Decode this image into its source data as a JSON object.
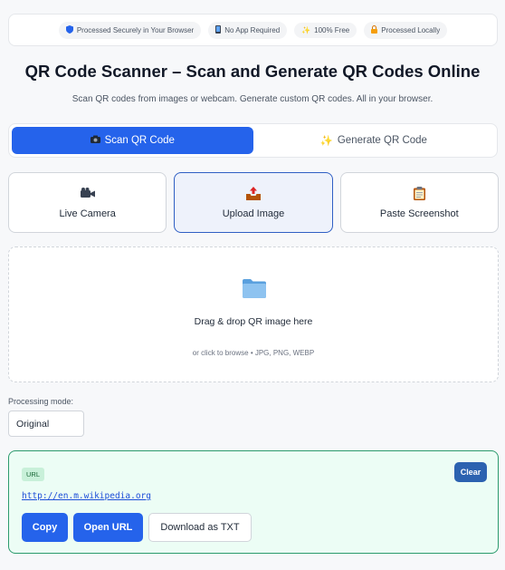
{
  "trust_bar": {
    "badges": [
      {
        "icon": "shield-icon",
        "label": "Processed Securely in Your Browser"
      },
      {
        "icon": "phone-icon",
        "label": "No App Required"
      },
      {
        "icon": "sparkle-icon",
        "label": "100% Free"
      },
      {
        "icon": "lock-icon",
        "label": "Processed Locally"
      }
    ]
  },
  "header": {
    "title": "QR Code Scanner – Scan and Generate QR Codes Online",
    "subtitle": "Scan QR codes from images or webcam. Generate custom QR codes. All in your browser."
  },
  "mode_tabs": [
    {
      "icon": "camera-icon",
      "label": "Scan QR Code",
      "active": true
    },
    {
      "icon": "sparkle-icon",
      "label": "Generate QR Code",
      "active": false
    }
  ],
  "sources": [
    {
      "icon": "video-camera-icon",
      "label": "Live Camera",
      "active": false
    },
    {
      "icon": "upload-tray-icon",
      "label": "Upload Image",
      "active": true
    },
    {
      "icon": "clipboard-icon",
      "label": "Paste Screenshot",
      "active": false
    }
  ],
  "dropzone": {
    "icon": "folder-icon",
    "title": "Drag & drop QR image here",
    "hint": "or click to browse • JPG, PNG, WEBP"
  },
  "processing": {
    "label": "Processing mode:",
    "selected": "Original"
  },
  "result": {
    "type": "URL",
    "clear_label": "Clear",
    "content": "http://en.m.wikipedia.org",
    "actions": {
      "copy": "Copy",
      "open_url": "Open URL",
      "download": "Download as TXT"
    }
  },
  "colors": {
    "accent": "#2563eb",
    "result_bg": "#ecfdf5",
    "result_border": "#2c9a6d"
  }
}
